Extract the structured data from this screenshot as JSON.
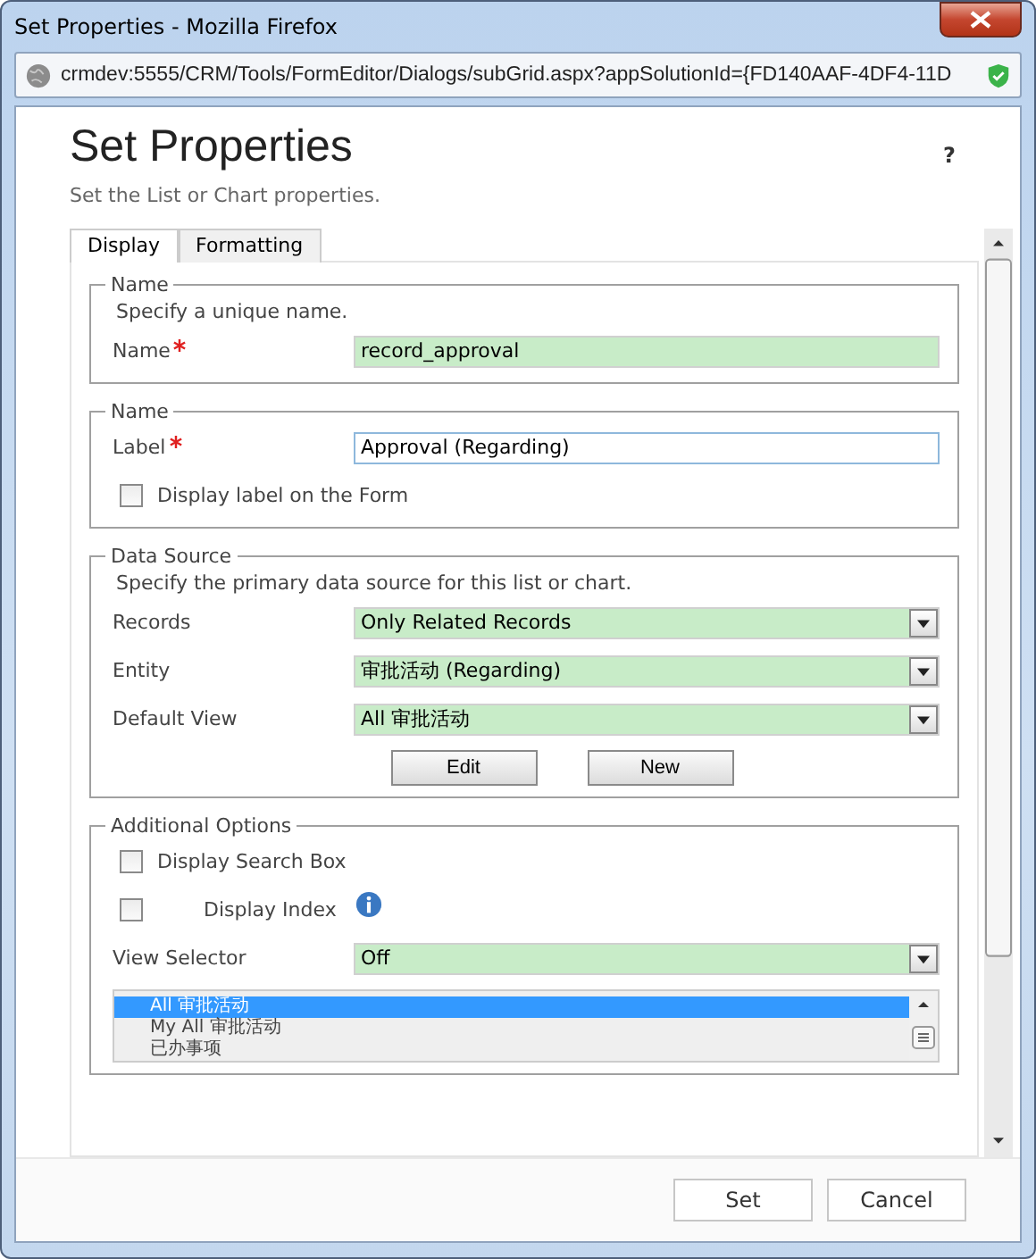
{
  "window": {
    "title": "Set Properties - Mozilla Firefox",
    "url": "crmdev:5555/CRM/Tools/FormEditor/Dialogs/subGrid.aspx?appSolutionId={FD140AAF-4DF4-11D"
  },
  "header": {
    "title": "Set Properties",
    "subtitle": "Set the List or Chart properties.",
    "help": "?"
  },
  "tabs": [
    {
      "label": "Display",
      "selected": true
    },
    {
      "label": "Formatting",
      "selected": false
    }
  ],
  "sections": [
    {
      "legend": "Name",
      "description": "Specify a unique name.",
      "fields": [
        {
          "kind": "text",
          "label": "Name",
          "required": true,
          "value": "record_approval",
          "highlighted": true
        }
      ]
    },
    {
      "legend": "Name",
      "fields": [
        {
          "kind": "text",
          "label": "Label",
          "required": true,
          "value": "Approval (Regarding)",
          "highlighted": false
        },
        {
          "kind": "checkbox",
          "label": "Display label on the Form",
          "checked": false
        }
      ]
    },
    {
      "legend": "Data Source",
      "description": "Specify the primary data source for this list or chart.",
      "fields": [
        {
          "kind": "select",
          "label": "Records",
          "value": "Only Related Records"
        },
        {
          "kind": "select",
          "label": "Entity",
          "value": "审批活动 (Regarding)"
        },
        {
          "kind": "select",
          "label": "Default View",
          "value": "All 审批活动"
        },
        {
          "kind": "buttons",
          "buttons": [
            "Edit",
            "New"
          ]
        }
      ]
    },
    {
      "legend": "Additional Options",
      "fields": [
        {
          "kind": "checkbox",
          "label": "Display Search Box",
          "checked": false
        },
        {
          "kind": "checkbox",
          "label": "Display Index",
          "checked": false,
          "info": true
        },
        {
          "kind": "select",
          "label": "View Selector",
          "value": "Off"
        },
        {
          "kind": "listbox",
          "items": [
            {
              "label": "All 审批活动",
              "selected": true
            },
            {
              "label": "My All 审批活动",
              "selected": false
            },
            {
              "label": "已办事项",
              "selected": false
            }
          ]
        }
      ]
    }
  ],
  "footer": {
    "buttons": [
      "Set",
      "Cancel"
    ]
  }
}
